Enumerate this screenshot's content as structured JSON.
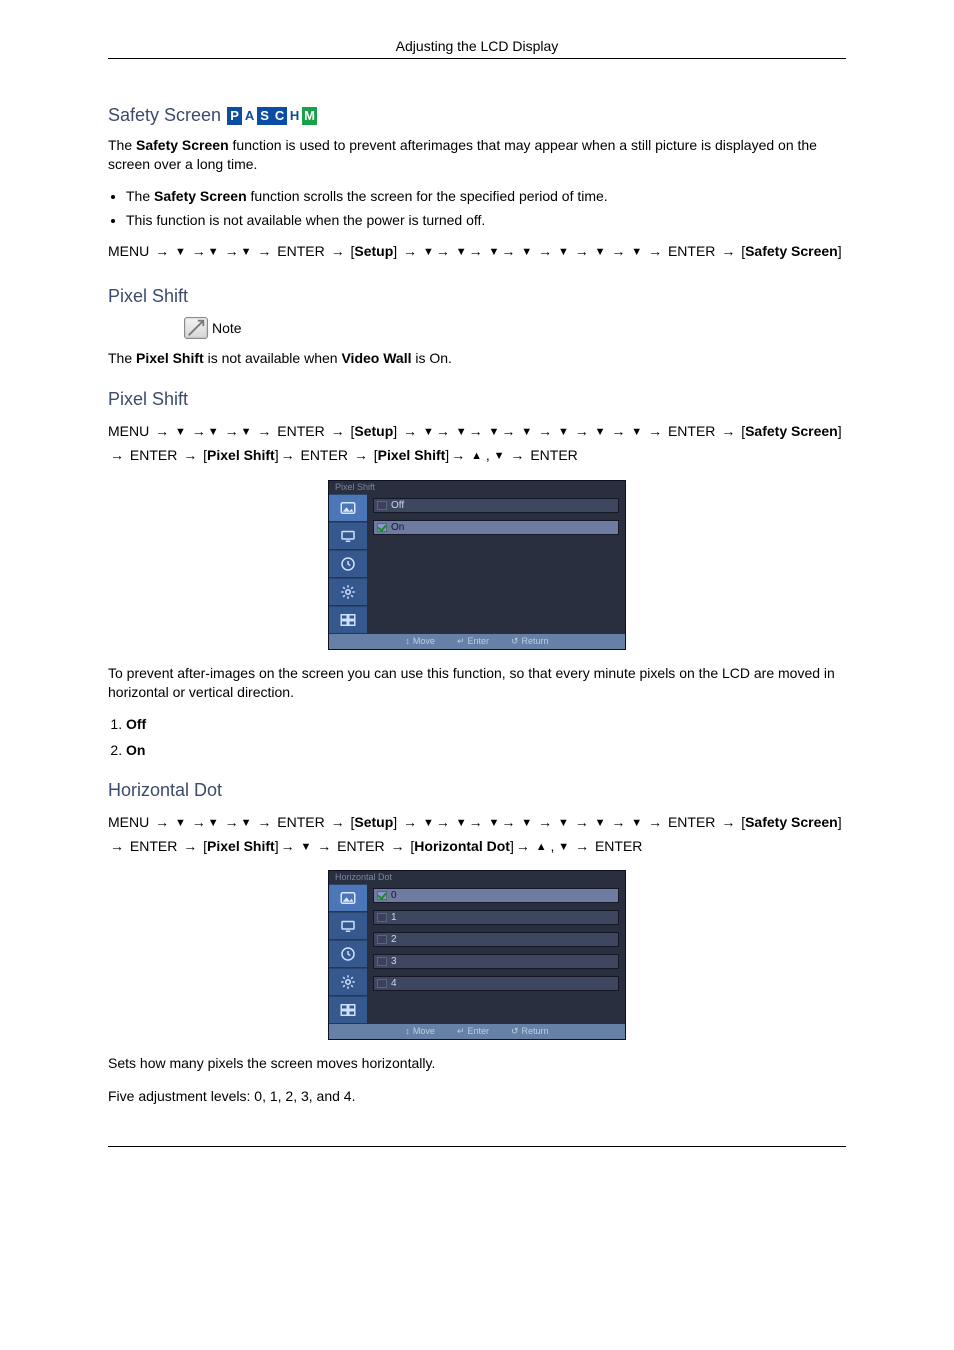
{
  "header": "Adjusting the LCD Display",
  "paschm": {
    "tiles": [
      {
        "t": "P",
        "bg": "#0b4da2",
        "fg": "#ffffff"
      },
      {
        "t": "A",
        "bg": "#ffffff",
        "fg": "#0b4da2"
      },
      {
        "t": "S",
        "bg": "#0b4da2",
        "fg": "#ffffff"
      },
      {
        "t": "C",
        "bg": "#0b4da2",
        "fg": "#ffffff"
      },
      {
        "t": "H",
        "bg": "#ffffff",
        "fg": "#0b4da2"
      },
      {
        "t": "M",
        "bg": "#18a04a",
        "fg": "#ffffff"
      }
    ]
  },
  "glyph": {
    "down": "▼",
    "up": "▲",
    "arrow": "→"
  },
  "s1": {
    "title": "Safety Screen",
    "intro_a": "The ",
    "intro_b": "Safety Screen",
    "intro_c": " function is used to prevent afterimages that may appear when a still picture is displayed on the screen over a long time.",
    "b1_a": "The ",
    "b1_b": "Safety Screen",
    "b1_c": " function scrolls the screen for the specified period of time.",
    "b2": "This function is not available when the power is turned off.",
    "seq_menu": "MENU",
    "seq_enter": "ENTER",
    "seq_setup": "Setup",
    "seq_target": "Safety Screen"
  },
  "s2": {
    "title": "Pixel Shift",
    "note": "Note",
    "line_a": "The ",
    "line_b": "Pixel Shift",
    "line_c": " is not available when ",
    "line_d": "Video Wall",
    "line_e": " is On."
  },
  "s3": {
    "title": "Pixel Shift",
    "seq_menu": "MENU",
    "seq_enter": "ENTER",
    "seq_setup": "Setup",
    "seq_t1": "Safety Screen",
    "seq_t2": "Pixel Shift",
    "seq_t3": "Pixel Shift",
    "osd_title": "Pixel Shift",
    "osd_items": [
      "Off",
      "On"
    ],
    "osd_sel": 1,
    "foot_move": "Move",
    "foot_enter": "Enter",
    "foot_return": "Return",
    "after": "To prevent after-images on the screen you can use this function, so that every minute pixels on the LCD are moved in horizontal or vertical direction.",
    "opt1": "Off",
    "opt2": "On"
  },
  "s4": {
    "title": "Horizontal Dot",
    "seq_menu": "MENU",
    "seq_enter": "ENTER",
    "seq_setup": "Setup",
    "seq_t1": "Safety Screen",
    "seq_t2": "Pixel Shift",
    "seq_t3": "Horizontal Dot",
    "osd_title": "Horizontal Dot",
    "osd_items": [
      "0",
      "1",
      "2",
      "3",
      "4"
    ],
    "osd_sel": 0,
    "foot_move": "Move",
    "foot_enter": "Enter",
    "foot_return": "Return",
    "after1": "Sets how many pixels the screen moves horizontally.",
    "after2": "Five adjustment levels: 0, 1, 2, 3, and 4."
  }
}
